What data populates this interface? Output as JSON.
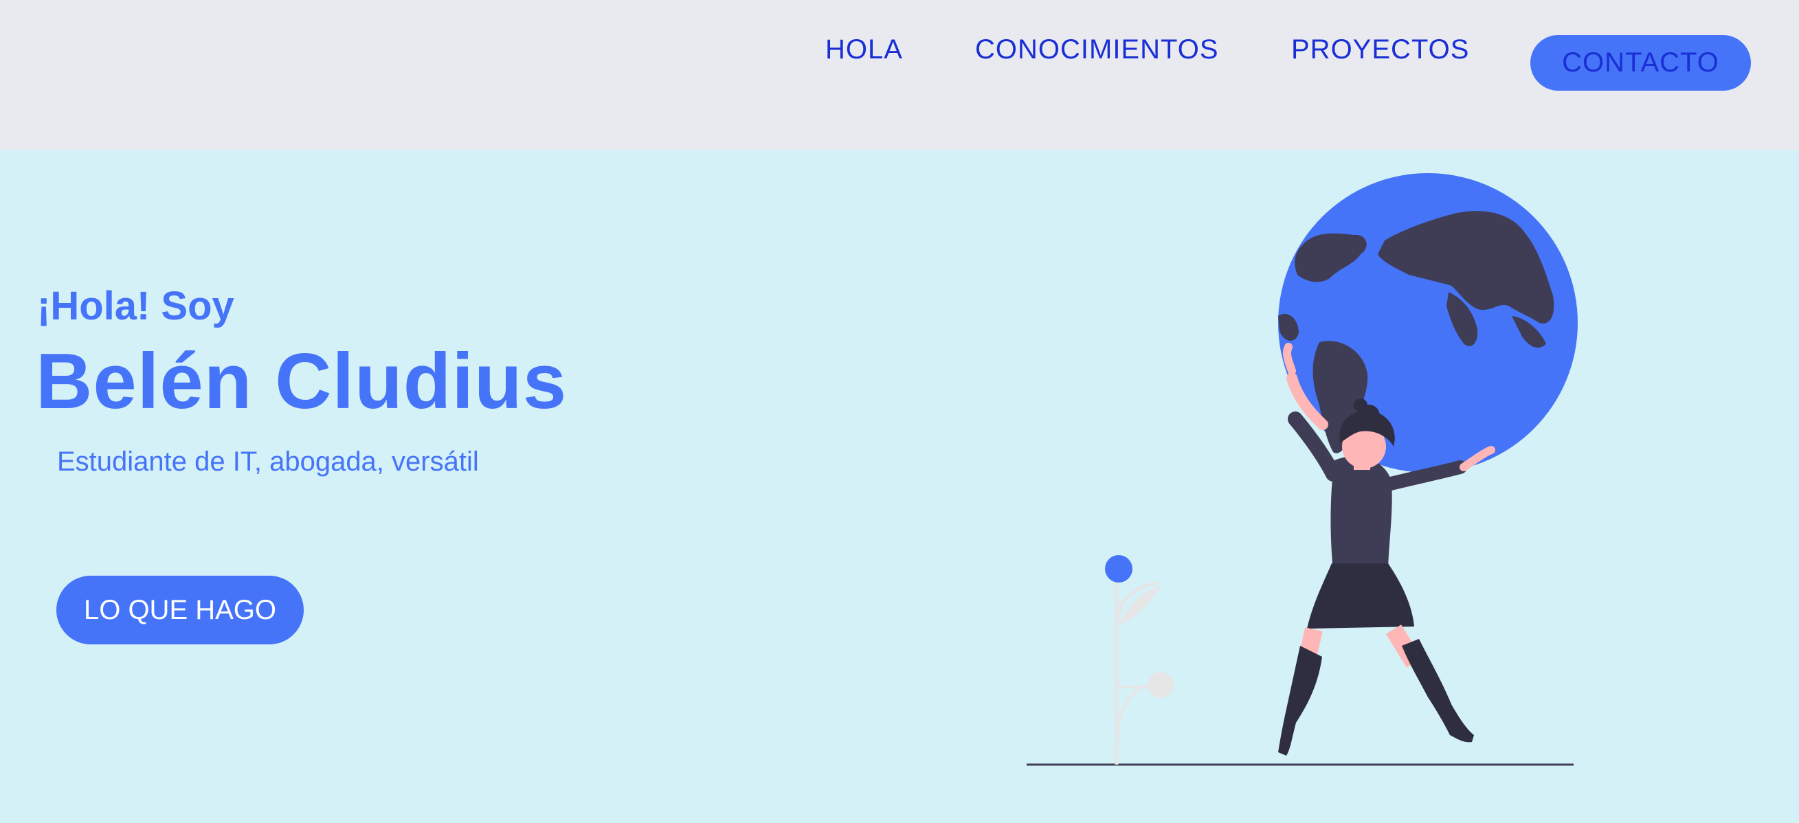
{
  "nav": {
    "items": [
      {
        "label": "HOLA"
      },
      {
        "label": "CONOCIMIENTOS"
      },
      {
        "label": "PROYECTOS"
      }
    ],
    "contact_label": "CONTACTO"
  },
  "hero": {
    "greeting": "¡Hola! Soy",
    "name": "Belén Cludius",
    "subtitle": "Estudiante de IT, abogada, versátil",
    "cta_label": "LO QUE HAGO"
  },
  "illustration": {
    "icon": "woman-holding-globe-illustration"
  },
  "colors": {
    "accent": "#4674f8",
    "nav_text": "#1a2ed6",
    "header_bg": "#e8eaf0",
    "hero_bg": "#d4f1f8",
    "figure_dark": "#3f3d56"
  }
}
